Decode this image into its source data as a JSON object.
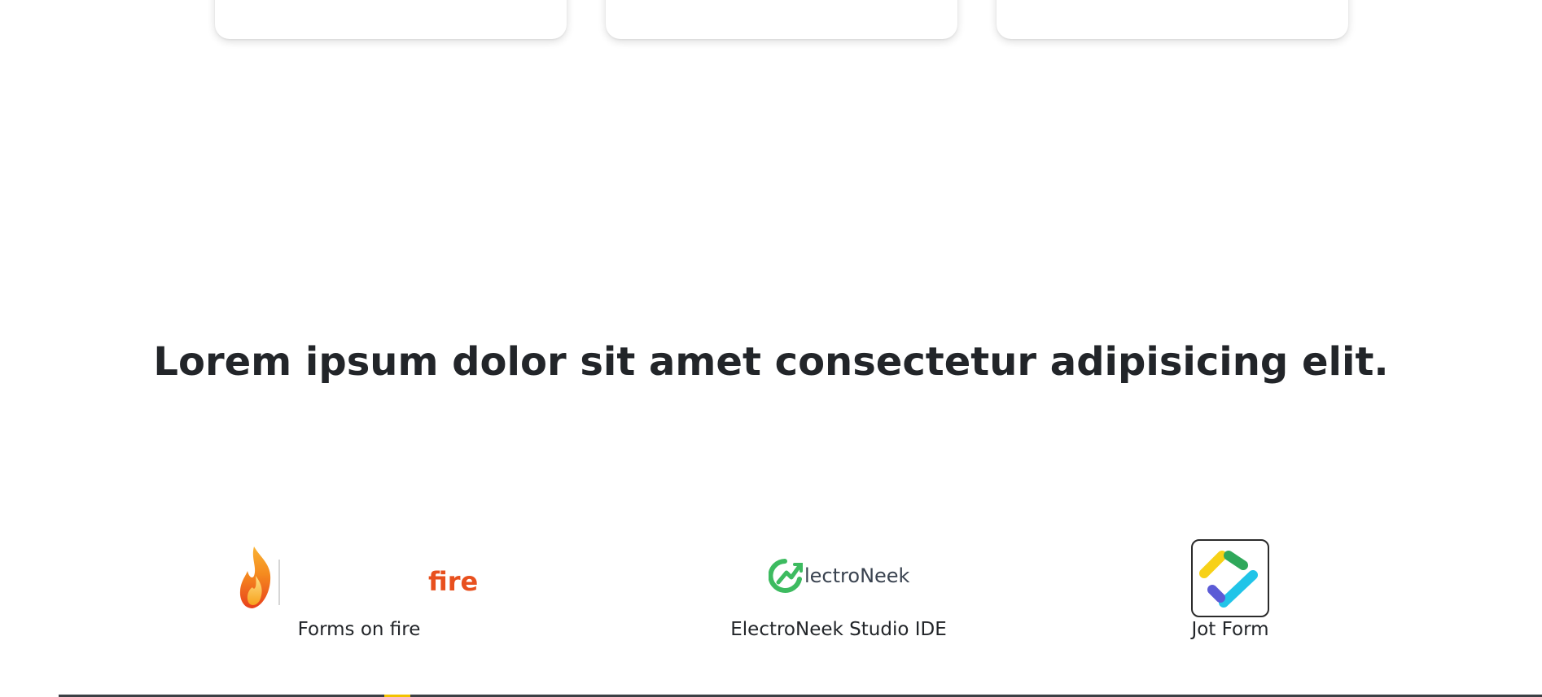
{
  "headline": "Lorem ipsum dolor sit amet consectetur adipisicing elit.",
  "partners": [
    {
      "name": "Forms on fire",
      "logo_text": "fire",
      "icon": "flame-logo-icon"
    },
    {
      "name": "ElectroNeek Studio IDE",
      "logo_text": "lectroNeek",
      "icon": "electroneek-logo-icon"
    },
    {
      "name": "Jot Form",
      "icon": "jotform-logo-icon"
    }
  ],
  "colors": {
    "text": "#222529",
    "fire_text": "#e8501e",
    "electroneek_green": "#3dbb60",
    "electroneek_text": "#3a4350"
  }
}
